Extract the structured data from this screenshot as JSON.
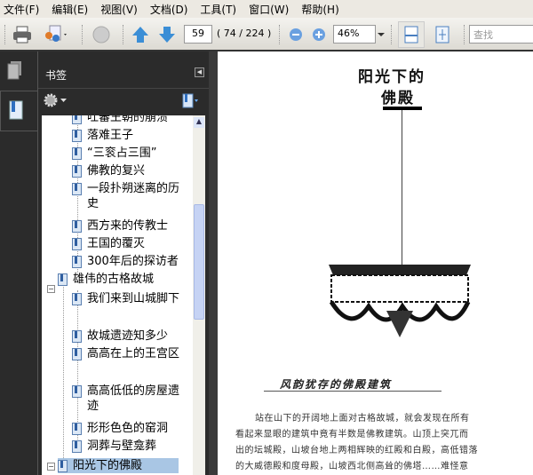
{
  "menu": [
    "文件(F)",
    "编辑(E)",
    "视图(V)",
    "文档(D)",
    "工具(T)",
    "窗口(W)",
    "帮助(H)"
  ],
  "toolbar": {
    "page_number": "59",
    "page_info": "( 74 / 224 )",
    "zoom": "46%",
    "search_placeholder": "查找"
  },
  "panel": {
    "title": "书签"
  },
  "bookmarks": [
    {
      "label": "吐蕃王朝的崩溃",
      "level": 2
    },
    {
      "label": "落难王子",
      "level": 2
    },
    {
      "label": "“三衮占三围”",
      "level": 2
    },
    {
      "label": "佛教的复兴",
      "level": 2
    },
    {
      "label": "一段扑朔迷离的历史",
      "level": 2
    },
    {
      "label": "西方来的传教士",
      "level": 2
    },
    {
      "label": "王国的覆灭",
      "level": 2
    },
    {
      "label": "300年后的探访者",
      "level": 2
    },
    {
      "label": "雄伟的古格故城",
      "level": 1
    },
    {
      "label": "我们来到山城脚下",
      "level": 2
    },
    {
      "label": "故城遗迹知多少",
      "level": 2
    },
    {
      "label": "高高在上的王宫区",
      "level": 2
    },
    {
      "label": "高高低低的房屋遗迹",
      "level": 2
    },
    {
      "label": "形形色色的窑洞",
      "level": 2
    },
    {
      "label": "洞葬与壁龛葬",
      "level": 2
    },
    {
      "label": "阳光下的佛殿",
      "level": 1,
      "selected": true
    }
  ],
  "document": {
    "title_line1": "阳光下的",
    "title_line2": "佛殿",
    "section_heading": "风韵犹存的佛殿建筑",
    "paragraph": [
      "站在山下的开阔地上面对古格故城，就会发现在所有",
      "看起来显眼的建筑中竟有半数是佛教建筑。山顶上突兀而",
      "出的坛城殿，山坡台地上两相辉映的红殿和白殿，高低错落",
      "的大威德殿和度母殿，山坡西北侧高耸的佛塔……难怪意"
    ]
  }
}
